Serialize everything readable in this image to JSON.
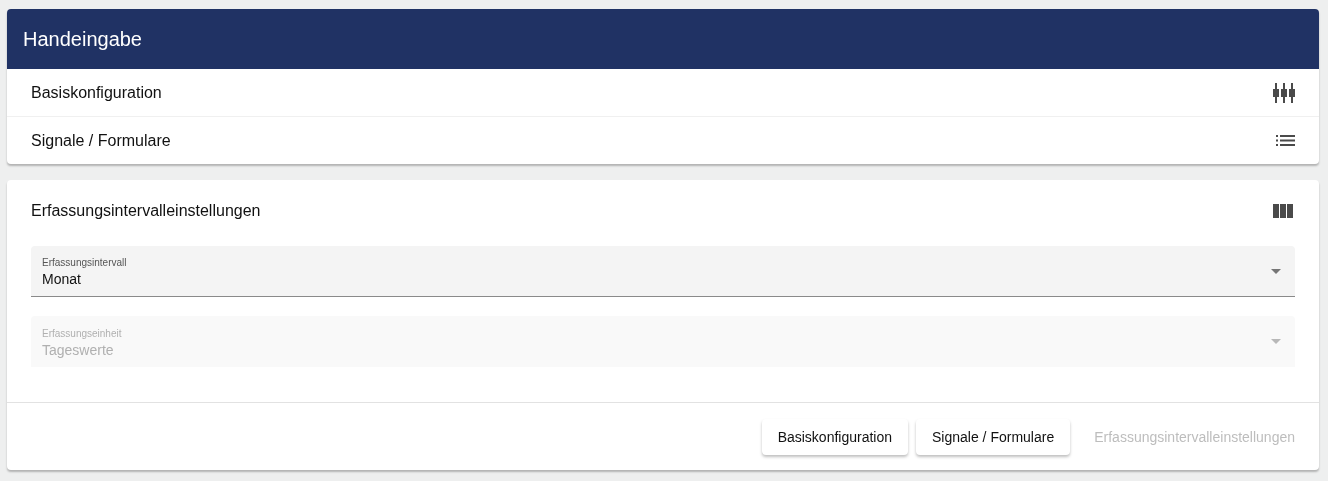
{
  "header": {
    "title": "Handeingabe"
  },
  "panels": [
    {
      "title": "Basiskonfiguration"
    },
    {
      "title": "Signale / Formulare"
    }
  ],
  "section": {
    "title": "Erfassungsintervalleinstellungen",
    "fields": [
      {
        "label": "Erfassungsintervall",
        "value": "Monat",
        "disabled": false
      },
      {
        "label": "Erfassungseinheit",
        "value": "Tageswerte",
        "disabled": true
      }
    ],
    "buttons": [
      {
        "label": "Basiskonfiguration",
        "disabled": false
      },
      {
        "label": "Signale / Formulare",
        "disabled": false
      },
      {
        "label": "Erfassungsintervalleinstellungen",
        "disabled": true
      }
    ]
  }
}
